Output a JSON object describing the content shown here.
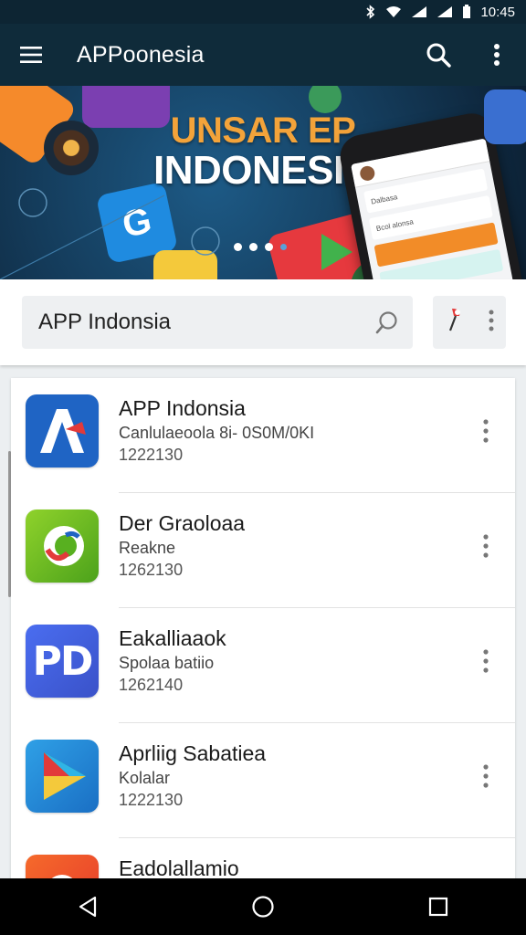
{
  "status": {
    "time": "10:45"
  },
  "app_bar": {
    "title": "APPoonesia"
  },
  "banner": {
    "line1": "UNSAR EP",
    "line2": "INDONESIA"
  },
  "phone": {
    "rows": [
      "Dalbasa",
      "Bcol alonsa",
      "",
      ""
    ]
  },
  "search": {
    "value": "APP Indonsia"
  },
  "list": [
    {
      "name": "APP Indonsia",
      "subtitle": "Canlulaeoola 8i- 0S0M/0KI",
      "code": "1222130",
      "icon": "letter-a-icon"
    },
    {
      "name": "Der Graoloaa",
      "subtitle": "Reakne",
      "code": "1262130",
      "icon": "green-c-icon"
    },
    {
      "name": "Eakalliaaok",
      "subtitle": "Spolaa batiio",
      "code": "1262140",
      "icon": "pd-icon"
    },
    {
      "name": "Aprliig Sabatiea",
      "subtitle": "Kolalar",
      "code": "1222130",
      "icon": "play-icon"
    },
    {
      "name": "Eadolallamio",
      "subtitle": "",
      "code": "",
      "icon": "orange-icon"
    }
  ],
  "colors": {
    "app_bar": "#0f2b3a",
    "banner_accent": "#f3a33a"
  }
}
